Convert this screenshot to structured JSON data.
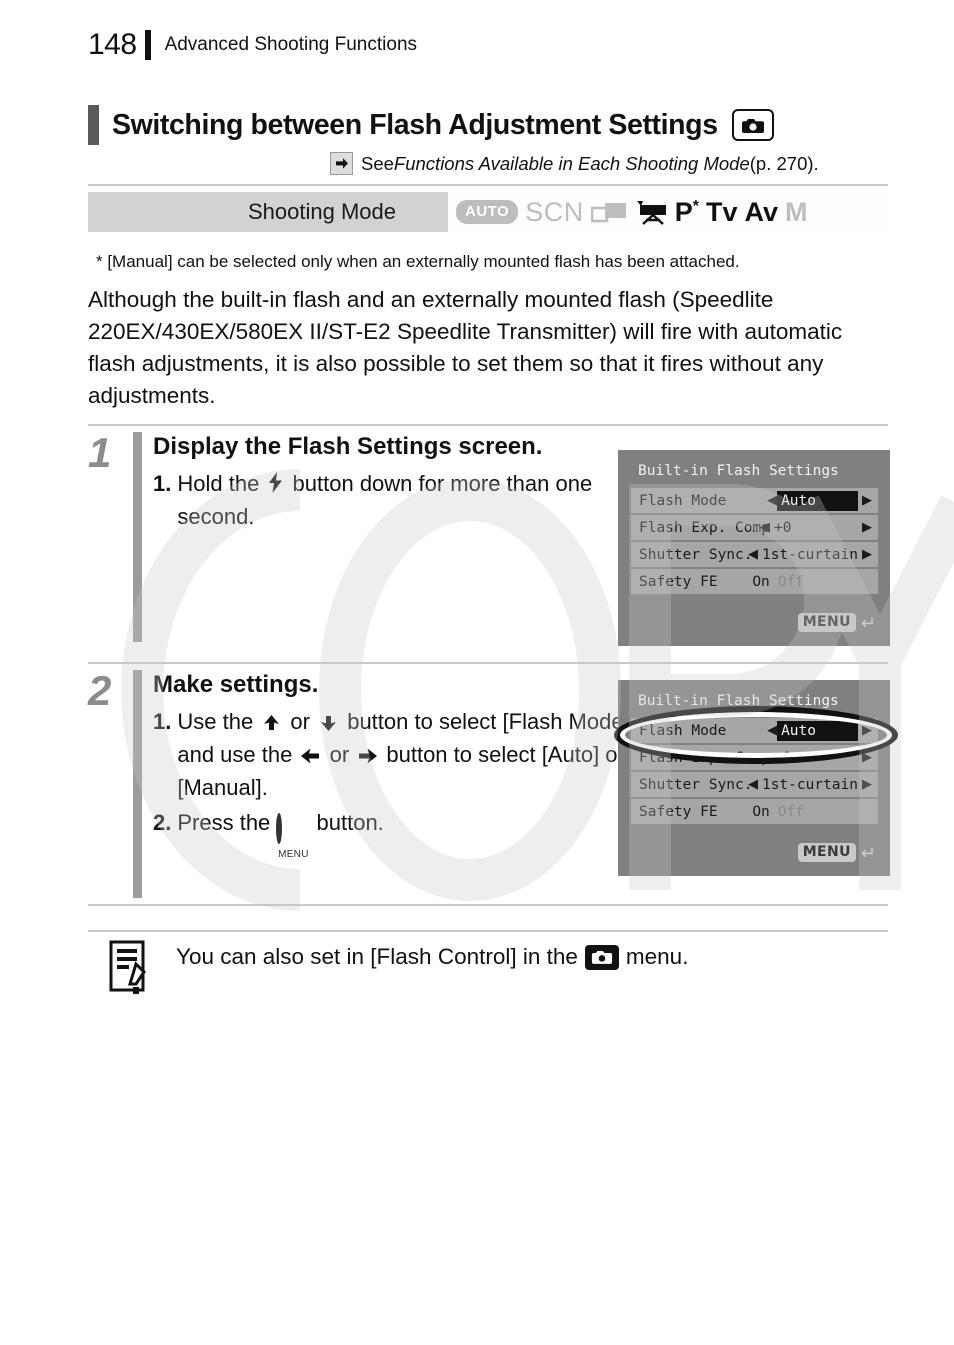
{
  "header": {
    "page_number": "148",
    "chapter": "Advanced Shooting Functions"
  },
  "section": {
    "title": "Switching between Flash Adjustment Settings",
    "title_icon": "camera-icon",
    "see_also_prefix": "See ",
    "see_also_italic": "Functions Available in Each Shooting Mode",
    "see_also_suffix": " (p. 270)."
  },
  "shooting_mode": {
    "label": "Shooting Mode",
    "modes": [
      {
        "name": "AUTO",
        "icon": "auto-mode-icon",
        "enabled": false
      },
      {
        "name": "SCN",
        "icon": "scn-mode-icon",
        "enabled": false
      },
      {
        "name": "Stitch",
        "icon": "stitch-assist-icon",
        "enabled": false
      },
      {
        "name": "Movie",
        "icon": "movie-mode-icon",
        "enabled": true
      },
      {
        "name": "P",
        "icon": "p-mode-icon",
        "enabled": true,
        "asterisk": "*"
      },
      {
        "name": "Tv",
        "icon": "tv-mode-icon",
        "enabled": true
      },
      {
        "name": "Av",
        "icon": "av-mode-icon",
        "enabled": true
      },
      {
        "name": "M",
        "icon": "m-mode-icon",
        "enabled": false
      }
    ]
  },
  "footnote": "* [Manual] can be selected only when an externally mounted flash has been attached.",
  "intro": "Although the built-in flash and an externally mounted flash (Speedlite 220EX/430EX/580EX II/ST-E2 Speedlite Transmitter) will fire with automatic flash adjustments, it is also possible to set them so that it fires without any adjustments.",
  "steps": [
    {
      "number": "1",
      "heading": "Display the Flash Settings screen.",
      "substeps": [
        {
          "marker": "1.",
          "text_before": "Hold the ",
          "inline_icon": "flash-icon",
          "text_after": " button down for more than one second."
        }
      ]
    },
    {
      "number": "2",
      "heading": "Make settings.",
      "substeps": [
        {
          "marker": "1.",
          "part1": "Use the ",
          "icon1": "up-arrow-icon",
          "part2": " or ",
          "icon2": "down-arrow-icon",
          "part3": " button to select [Flash Mode] and use the ",
          "icon3": "left-arrow-icon",
          "part4": " or ",
          "icon4": "right-arrow-icon",
          "part5": " button to select [Auto] or [Manual]."
        },
        {
          "marker": "2.",
          "part1": "Press the ",
          "icon1": "menu-button-icon",
          "icon1_caption": "MENU",
          "part2": " button."
        }
      ]
    }
  ],
  "lcd_screens": [
    {
      "id": "screen-step1",
      "title": "Built-in Flash Settings",
      "rows": [
        {
          "label": "Flash Mode",
          "value": "Auto",
          "selected": true,
          "left_caret": true,
          "right_caret": true
        },
        {
          "label": "Flash Exp. Comp",
          "value": "+0",
          "selected": false,
          "left_caret": true,
          "right_caret": true
        },
        {
          "label": "Shutter Sync.",
          "value": "1st-curtain",
          "selected": false,
          "left_caret": true,
          "right_caret": true
        },
        {
          "label": "Safety FE",
          "value_on": "On",
          "value_off": "Off",
          "toggle": true
        }
      ],
      "menu_badge": "MENU",
      "menu_return_icon": "return-arrow-icon",
      "highlight": false
    },
    {
      "id": "screen-step2",
      "title": "Built-in Flash Settings",
      "rows": [
        {
          "label": "Flash Mode",
          "value": "Auto",
          "selected": true,
          "left_caret": true,
          "right_caret": true
        },
        {
          "label": "Flash Exp. Comp",
          "value": "+0",
          "selected": false,
          "left_caret": true,
          "right_caret": true
        },
        {
          "label": "Shutter Sync.",
          "value": "1st-curtain",
          "selected": false,
          "left_caret": true,
          "right_caret": true
        },
        {
          "label": "Safety FE",
          "value_on": "On",
          "value_off": "Off",
          "toggle": true
        }
      ],
      "menu_badge": "MENU",
      "menu_return_icon": "return-arrow-icon",
      "highlight": true
    }
  ],
  "note": {
    "icon": "memo-note-icon",
    "text_before": "You can also set in [Flash Control] in the ",
    "inline_icon": "camera-menu-icon",
    "text_after": " menu."
  },
  "colors": {
    "accent_bar": "#595959",
    "step_bar": "#9c9c9c",
    "mode_bar_bg": "#d2d2d2",
    "lcd_bg": "#808080",
    "lcd_row": "#a6a6a6",
    "disabled": "#bdbdbd"
  }
}
